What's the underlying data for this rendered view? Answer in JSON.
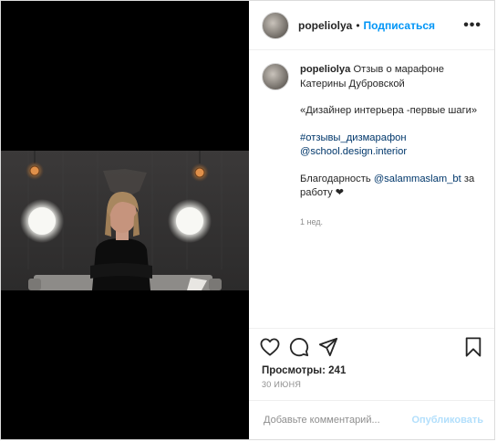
{
  "header": {
    "username": "popeliolya",
    "separator": "•",
    "follow_label": "Подписаться",
    "more_icon": "more-horizontal-icon",
    "more_glyph": "•••"
  },
  "caption": {
    "username": "popeliolya",
    "line1": "Отзыв о марафоне Катерины Дубровской",
    "line2": "«Дизайнер интерьера -первые шаги»",
    "hashtag": "#отзывы_дизмарафон",
    "mention_school": "@school.design.interior",
    "thanks_prefix": "Благодарность ",
    "mention_user": "@salammaslam_bt",
    "thanks_suffix": " за работу ❤",
    "time": "1 нед."
  },
  "actions": {
    "like_icon": "heart-icon",
    "comment_icon": "comment-icon",
    "share_icon": "share-icon",
    "save_icon": "bookmark-icon"
  },
  "stats": {
    "views": "Просмотры: 241",
    "date": "30 ИЮНЯ"
  },
  "comment_box": {
    "placeholder": "Добавьте комментарий...",
    "publish_label": "Опубликовать"
  },
  "colors": {
    "accent": "#0095f6",
    "link": "#00376b",
    "muted": "#8e8e8e",
    "publish_disabled": "#b2dffc"
  }
}
